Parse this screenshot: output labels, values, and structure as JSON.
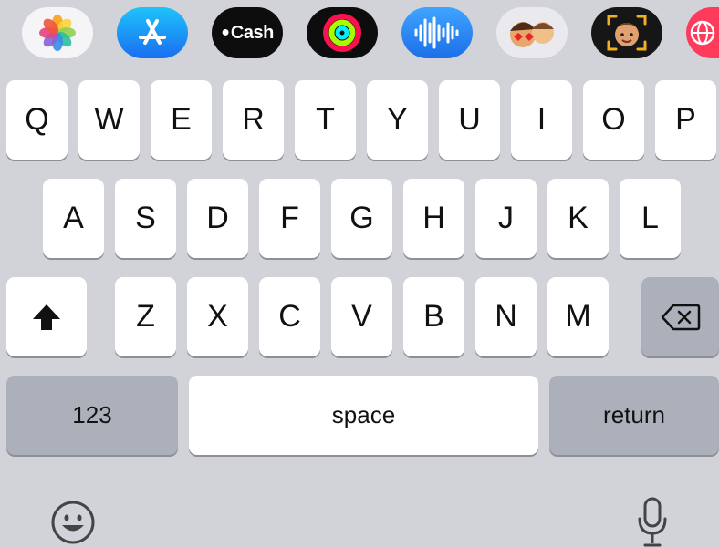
{
  "app_strip": {
    "apps": [
      {
        "name": "Photos",
        "icon": "photos-icon"
      },
      {
        "name": "App Store",
        "icon": "app-store-icon"
      },
      {
        "name": "Cash",
        "icon": "cash-icon",
        "label": "Cash"
      },
      {
        "name": "Activity",
        "icon": "activity-rings-icon"
      },
      {
        "name": "Voice Memo",
        "icon": "audio-waveform-icon"
      },
      {
        "name": "Memoji Stickers",
        "icon": "memoji-stickers-icon"
      },
      {
        "name": "Memoji",
        "icon": "memoji-icon"
      },
      {
        "name": "Web Search",
        "icon": "globe-icon"
      }
    ]
  },
  "keyboard": {
    "row1": [
      "Q",
      "W",
      "E",
      "R",
      "T",
      "Y",
      "U",
      "I",
      "O",
      "P"
    ],
    "row2": [
      "A",
      "S",
      "D",
      "F",
      "G",
      "H",
      "J",
      "K",
      "L"
    ],
    "row3": [
      "Z",
      "X",
      "C",
      "V",
      "B",
      "N",
      "M"
    ],
    "numbers_label": "123",
    "space_label": "space",
    "return_label": "return"
  },
  "icons": {
    "shift": "shift-arrow-icon",
    "delete": "backspace-icon",
    "emoji": "emoji-icon",
    "dictation": "microphone-icon"
  },
  "colors": {
    "keyboard_background": "#d1d3d9",
    "letter_key": "#ffffff",
    "function_key": "#abb0ba",
    "key_text": "#111111"
  }
}
